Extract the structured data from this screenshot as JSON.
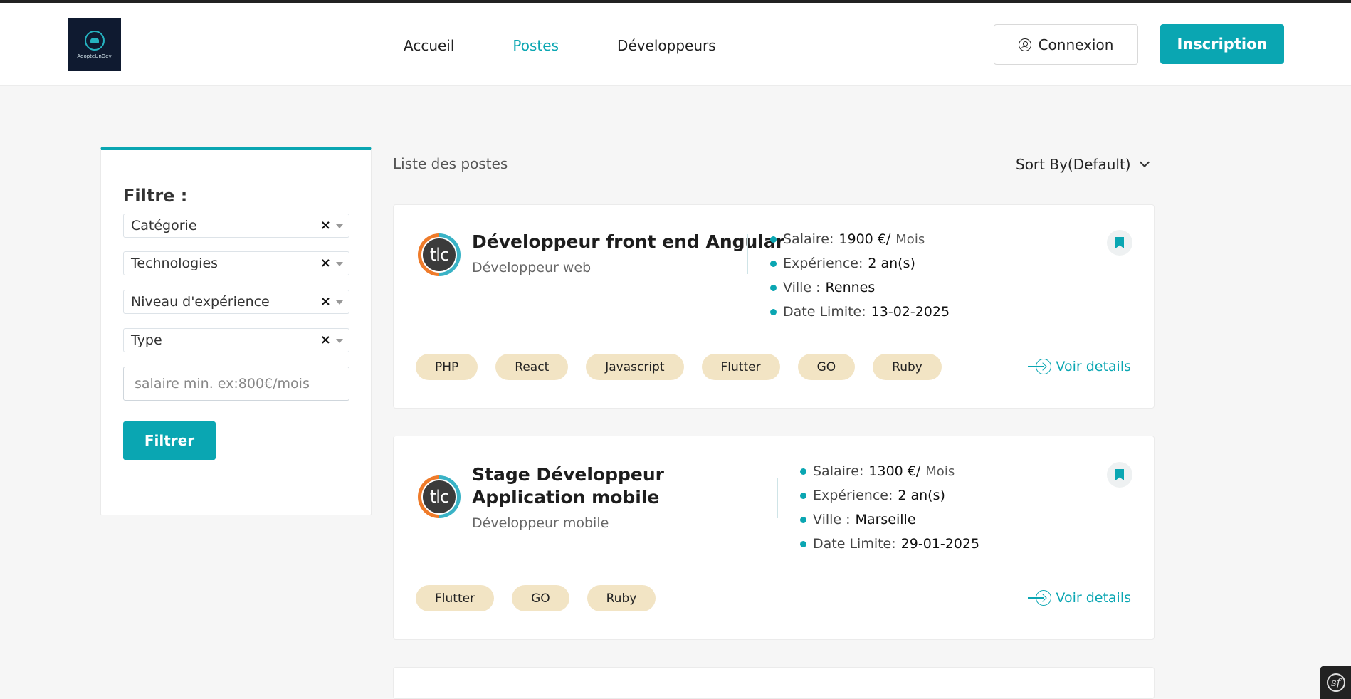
{
  "header": {
    "logo_text": "AdopteUnDev",
    "nav": [
      {
        "label": "Accueil",
        "active": false
      },
      {
        "label": "Postes",
        "active": true
      },
      {
        "label": "Développeurs",
        "active": false
      }
    ],
    "login_label": "Connexion",
    "signup_label": "Inscription"
  },
  "filters": {
    "title": "Filtre :",
    "selects": [
      "Catégorie",
      "Technologies",
      "Niveau d'expérience",
      "Type"
    ],
    "clear_symbol": "×",
    "salary_placeholder": "salaire min. ex:800€/mois",
    "submit_label": "Filtrer"
  },
  "list": {
    "title": "Liste des postes",
    "sort_label": "Sort By(Default)",
    "details_label": "Voir details",
    "jobs": [
      {
        "company_logo_text": "tlc",
        "title": "Développeur front end Angular",
        "category": "Développeur web",
        "salary_label": "Salaire:",
        "salary_value": "1900 €/",
        "salary_unit": "Mois",
        "experience_label": "Expérience:",
        "experience_value": "2 an(s)",
        "city_label": "Ville :",
        "city_value": "Rennes",
        "deadline_label": "Date Limite:",
        "deadline_value": "13-02-2025",
        "tags": [
          "PHP",
          "React",
          "Javascript",
          "Flutter",
          "GO",
          "Ruby"
        ]
      },
      {
        "company_logo_text": "tlc",
        "title": "Stage Développeur Application mobile",
        "category": "Développeur mobile",
        "salary_label": "Salaire:",
        "salary_value": "1300 €/",
        "salary_unit": "Mois",
        "experience_label": "Expérience:",
        "experience_value": "2 an(s)",
        "city_label": "Ville :",
        "city_value": "Marseille",
        "deadline_label": "Date Limite:",
        "deadline_value": "29-01-2025",
        "tags": [
          "Flutter",
          "GO",
          "Ruby"
        ]
      }
    ]
  },
  "colors": {
    "accent": "#0aa6b2",
    "tag_bg": "#f2e4c4",
    "page_bg": "#f6f6f6"
  },
  "icons": {
    "login": "user-circle-icon",
    "bookmark": "bookmark-icon",
    "details": "arrow-right-circle-icon",
    "sort": "chevron-down-icon",
    "debug": "symfony-icon"
  }
}
